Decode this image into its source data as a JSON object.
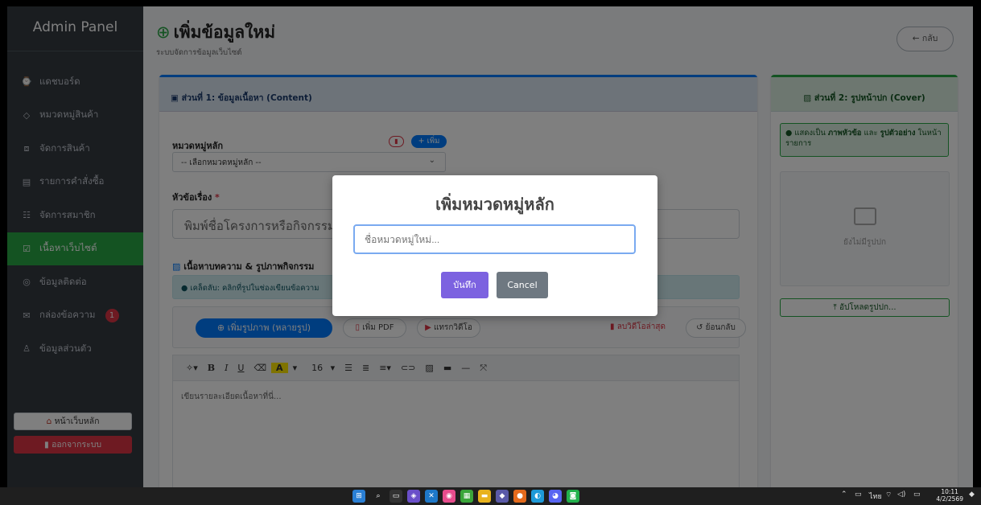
{
  "sidebar": {
    "brand": "Admin Panel",
    "items": [
      {
        "icon": "⌚",
        "label": "แดชบอร์ด"
      },
      {
        "icon": "◇",
        "label": "หมวดหมู่สินค้า"
      },
      {
        "icon": "⧈",
        "label": "จัดการสินค้า"
      },
      {
        "icon": "▤",
        "label": "รายการคำสั่งซื้อ"
      },
      {
        "icon": "☷",
        "label": "จัดการสมาชิก"
      },
      {
        "icon": "☑",
        "label": "เนื้อหาเว็บไซต์"
      },
      {
        "icon": "◎",
        "label": "ข้อมูลติดต่อ"
      },
      {
        "icon": "✉",
        "label": "กล่องข้อความ",
        "badge": "1"
      },
      {
        "icon": "♙",
        "label": "ข้อมูลส่วนตัว"
      }
    ],
    "home_button": "หน้าเว็บหลัก",
    "logout_button": "ออกจากระบบ"
  },
  "header": {
    "icon": "⊕",
    "title": "เพิ่มข้อมูลใหม่",
    "subtitle": "ระบบจัดการข้อมูลเว็บไซต์",
    "back_button": "← กลับ"
  },
  "content_card": {
    "heading": "ส่วนที่ 1: ข้อมูลเนื้อหา (Content)",
    "category_label": "หมวดหมู่หลัก",
    "add_category_button": "+ เพิ่ม",
    "category_select": "-- เลือกหมวดหมู่หลัก --",
    "title_label": "หัวข้อเรื่อง",
    "title_required": "*",
    "title_placeholder": "พิมพ์ชื่อโครงการหรือกิจกรรม",
    "body_label": "เนื้อหาบทความ & รูปภาพกิจกรรม",
    "tip": "เคล็ดลับ: คลิกที่รูปในช่องเขียนข้อความ",
    "add_images_button": "เพิ่มรูปภาพ (หลายรูป)",
    "add_pdf_button": "เพิ่ม PDF",
    "insert_video_button": "แทรกวิดีโอ",
    "delete_video_button": "ลบวิดีโอล่าสุด",
    "undo_button": "ย้อนกลับ",
    "font_size": "16",
    "editor_placeholder": "เขียนรายละเอียดเนื้อหาที่นี่..."
  },
  "cover_card": {
    "heading": "ส่วนที่ 2: รูปหน้าปก (Cover)",
    "notice_prefix": "แสดงเป็น ",
    "notice_bold1": "ภาพหัวข้อ",
    "notice_mid": " และ ",
    "notice_bold2": "รูปตัวอย่าง",
    "notice_suffix": " ในหน้ารายการ",
    "no_cover": "ยังไม่มีรูปปก",
    "upload_button": "อัปโหลดรูปปก..."
  },
  "modal": {
    "title": "เพิ่มหมวดหมู่หลัก",
    "input_placeholder": "ชื่อหมวดหมู่ใหม่...",
    "save_button": "บันทึก",
    "cancel_button": "Cancel"
  },
  "taskbar": {
    "clock_time": "10:11",
    "clock_date": "4/2/2569",
    "lang": "ไทย"
  },
  "colors": {
    "sidebar": "#343a40",
    "active": "#28a745",
    "primary": "#007bff",
    "danger": "#dc3545",
    "modal_confirm": "#7c62e0"
  }
}
